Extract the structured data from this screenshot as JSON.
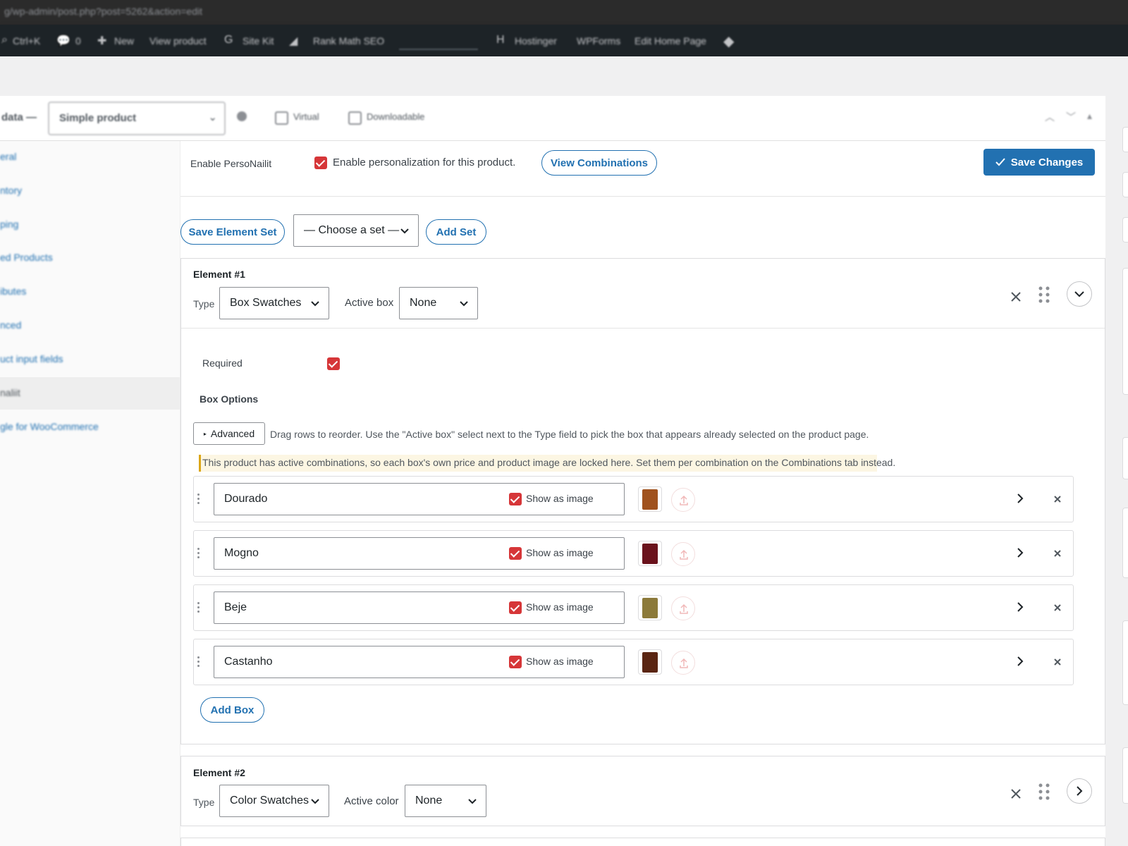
{
  "browser": {
    "url": "g/wp-admin/post.php?post=5262&action=edit"
  },
  "admin_bar": {
    "items": [
      "Ctrl+K",
      "0",
      "New",
      "View product",
      "Site Kit",
      "Rank Math SEO",
      "Hostinger",
      "WPForms",
      "Edit Home Page"
    ]
  },
  "product_data": {
    "label": "data —",
    "product_type": "Simple product",
    "virtual_label": "Virtual",
    "downloadable_label": "Downloadable"
  },
  "tabs": [
    "eral",
    "ntory",
    "ping",
    "ed Products",
    "ibutes",
    "nced",
    "uct input fields",
    "naliit",
    "gle for WooCommerce"
  ],
  "personalit": {
    "enable_label": "Enable PersoNailit",
    "enable_checkbox_label": "Enable personalization for this product.",
    "view_combinations": "View Combinations",
    "save_changes": "Save Changes",
    "save_element_set": "Save Element Set",
    "choose_set": "— Choose a set —",
    "add_set": "Add Set"
  },
  "element1": {
    "title": "Element #1",
    "type_label": "Type",
    "type_value": "Box Swatches",
    "active_label": "Active box",
    "active_value": "None",
    "required_label": "Required",
    "box_options_label": "Box Options",
    "advanced_label": "Advanced",
    "hint": "Drag rows to reorder. Use the \"Active box\" select next to the Type field to pick the box that appears already selected on the product page.",
    "notice": "This product has active combinations, so each box's own price and product image are locked here. Set them per combination on the Combinations tab instead.",
    "add_box": "Add Box",
    "boxes": [
      {
        "name": "Dourado",
        "show_as_image": "Show as image",
        "color": "#a0521d"
      },
      {
        "name": "Mogno",
        "show_as_image": "Show as image",
        "color": "#6a121c"
      },
      {
        "name": "Beje",
        "show_as_image": "Show as image",
        "color": "#8c7a3a"
      },
      {
        "name": "Castanho",
        "show_as_image": "Show as image",
        "color": "#5a2512"
      }
    ]
  },
  "element2": {
    "title": "Element #2",
    "type_label": "Type",
    "type_value": "Color Swatches",
    "active_label": "Active color",
    "active_value": "None"
  },
  "colors": {
    "accent": "#2271b1",
    "checkbox": "#d63638",
    "notice_bg": "#fcf6e3"
  }
}
